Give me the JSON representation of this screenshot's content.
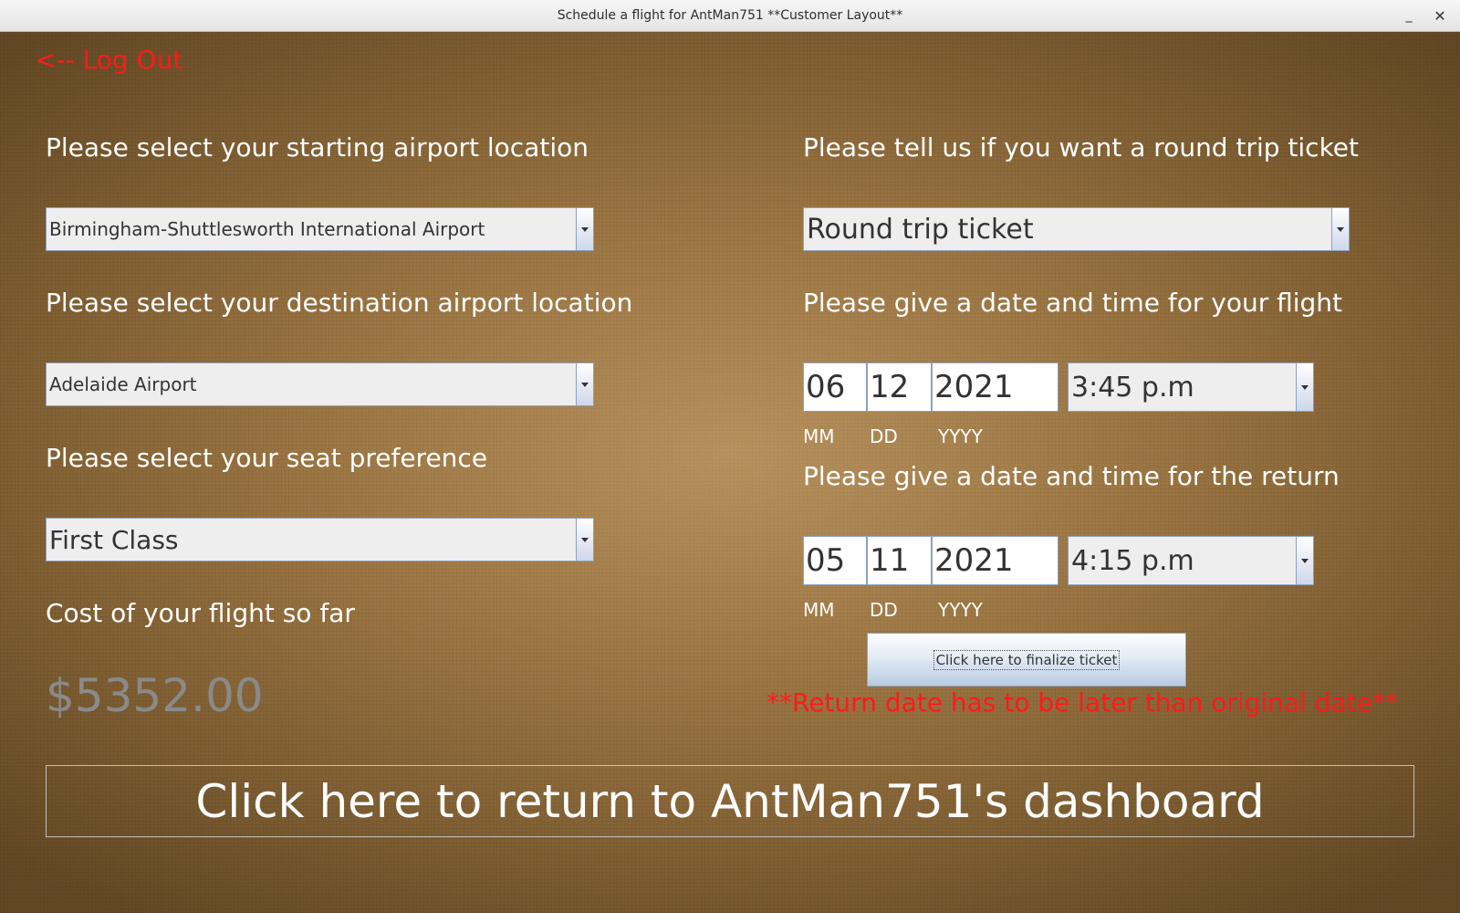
{
  "window": {
    "title": "Schedule a flight for AntMan751  **Customer Layout**",
    "minimize_glyph": "_",
    "close_glyph": "✕"
  },
  "logout": {
    "label": "<-- Log Out"
  },
  "left": {
    "start_label": "Please select your starting airport location",
    "start_value": "Birmingham-Shuttlesworth International Airport",
    "dest_label": "Please select your destination airport location",
    "dest_value": "Adelaide Airport",
    "seat_label": "Please select your seat preference",
    "seat_value": "First Class",
    "cost_label": "Cost of your flight so far",
    "cost_value": "$5352.00"
  },
  "right": {
    "trip_label": "Please tell us if you want a round trip ticket",
    "trip_value": "Round trip ticket",
    "depart_label": "Please give a date and time for your flight",
    "depart": {
      "mm": "06",
      "dd": "12",
      "yyyy": "2021",
      "time": "3:45 p.m"
    },
    "return_label": "Please give a date and time for the return",
    "return": {
      "mm": "05",
      "dd": "11",
      "yyyy": "2021",
      "time": "4:15 p.m"
    },
    "mm_caption": "MM",
    "dd_caption": "DD",
    "yyyy_caption": "YYYY",
    "finalize_label": "Click here to finalize ticket",
    "error_text": "**Return date has to be later than original date**"
  },
  "dashboard_button": {
    "label": "Click here to return to AntMan751's dashboard"
  },
  "colors": {
    "error": "#ff1a1a",
    "label": "#ffffff",
    "cost": "#8a8a8a",
    "background": "#93703f"
  }
}
